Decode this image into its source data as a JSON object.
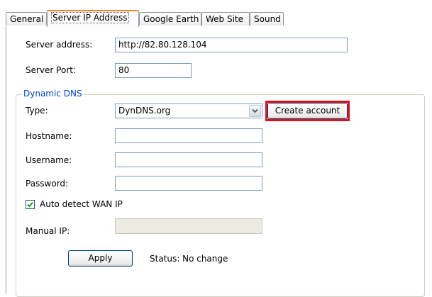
{
  "tabs": [
    {
      "label": "General",
      "active": false
    },
    {
      "label": "Server IP Address",
      "active": true
    },
    {
      "label": "Google Earth",
      "active": false
    },
    {
      "label": "Web Site",
      "active": false
    },
    {
      "label": "Sound",
      "active": false
    }
  ],
  "server": {
    "address_label": "Server address:",
    "address_value": "http://82.80.128.104",
    "port_label": "Server Port:",
    "port_value": "80"
  },
  "ddns": {
    "group_title": "Dynamic DNS",
    "type_label": "Type:",
    "type_value": "DynDNS.org",
    "create_account_label": "Create account",
    "hostname_label": "Hostname:",
    "hostname_value": "",
    "username_label": "Username:",
    "username_value": "",
    "password_label": "Password:",
    "password_value": "",
    "auto_detect_label": "Auto detect WAN IP",
    "auto_detect_checked": true,
    "manual_ip_label": "Manual IP:",
    "manual_ip_value": "",
    "apply_label": "Apply",
    "status_text": "Status: No change"
  },
  "colors": {
    "highlight": "#e0131b",
    "group_title": "#0046d5",
    "active_tab_accent": "#e68b2c"
  }
}
